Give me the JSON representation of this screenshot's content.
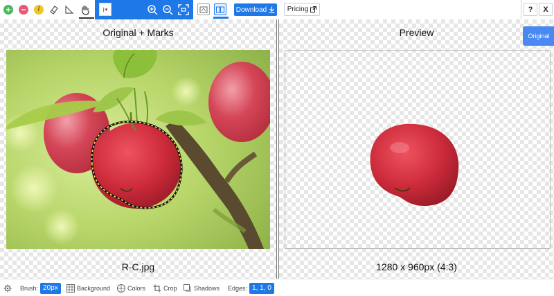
{
  "toolbar": {
    "tools": [
      "add-mark-icon",
      "remove-mark-icon",
      "pencil-icon",
      "eraser-icon",
      "ruler-icon",
      "hand-icon"
    ],
    "colors": {
      "add": "#4cba5a",
      "remove": "#e55a7a",
      "pencil": "#f0c62a",
      "accent": "#1f78e8"
    },
    "select_value": "i",
    "download_label": "Download",
    "pricing_label": "Pricing",
    "help_label": "?",
    "close_label": "X"
  },
  "left_panel": {
    "title": "Original + Marks",
    "caption": "R-C.jpg"
  },
  "right_panel": {
    "title": "Preview",
    "caption": "1280 x 960px (4:3)",
    "original_button": "Original"
  },
  "bottom_bar": {
    "brush_label": "Brush:",
    "brush_value": "20px",
    "background_label": "Background",
    "colors_label": "Colors",
    "crop_label": "Crop",
    "shadows_label": "Shadows",
    "edges_label": "Edges:",
    "edges_value": "1, 1, 0"
  }
}
